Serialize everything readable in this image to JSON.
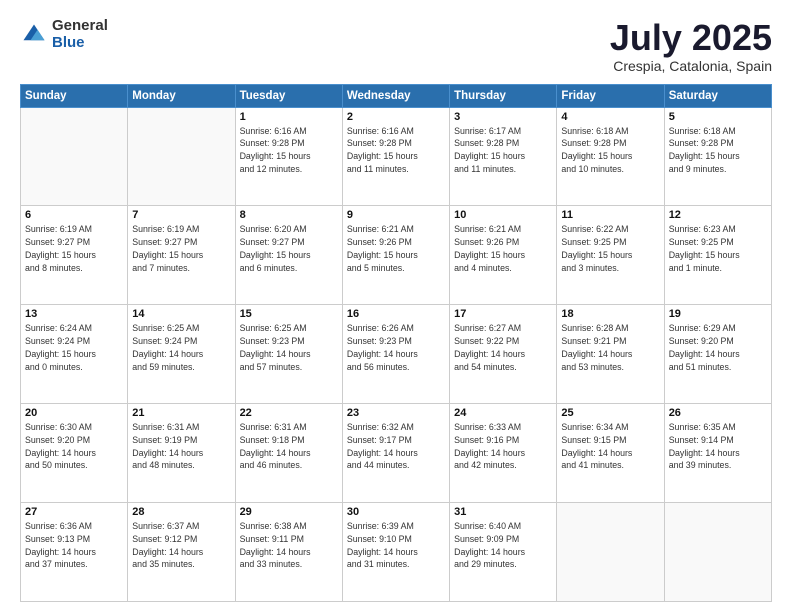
{
  "logo": {
    "general": "General",
    "blue": "Blue"
  },
  "title": {
    "month": "July 2025",
    "location": "Crespia, Catalonia, Spain"
  },
  "weekdays": [
    "Sunday",
    "Monday",
    "Tuesday",
    "Wednesday",
    "Thursday",
    "Friday",
    "Saturday"
  ],
  "weeks": [
    [
      {
        "day": "",
        "info": ""
      },
      {
        "day": "",
        "info": ""
      },
      {
        "day": "1",
        "info": "Sunrise: 6:16 AM\nSunset: 9:28 PM\nDaylight: 15 hours\nand 12 minutes."
      },
      {
        "day": "2",
        "info": "Sunrise: 6:16 AM\nSunset: 9:28 PM\nDaylight: 15 hours\nand 11 minutes."
      },
      {
        "day": "3",
        "info": "Sunrise: 6:17 AM\nSunset: 9:28 PM\nDaylight: 15 hours\nand 11 minutes."
      },
      {
        "day": "4",
        "info": "Sunrise: 6:18 AM\nSunset: 9:28 PM\nDaylight: 15 hours\nand 10 minutes."
      },
      {
        "day": "5",
        "info": "Sunrise: 6:18 AM\nSunset: 9:28 PM\nDaylight: 15 hours\nand 9 minutes."
      }
    ],
    [
      {
        "day": "6",
        "info": "Sunrise: 6:19 AM\nSunset: 9:27 PM\nDaylight: 15 hours\nand 8 minutes."
      },
      {
        "day": "7",
        "info": "Sunrise: 6:19 AM\nSunset: 9:27 PM\nDaylight: 15 hours\nand 7 minutes."
      },
      {
        "day": "8",
        "info": "Sunrise: 6:20 AM\nSunset: 9:27 PM\nDaylight: 15 hours\nand 6 minutes."
      },
      {
        "day": "9",
        "info": "Sunrise: 6:21 AM\nSunset: 9:26 PM\nDaylight: 15 hours\nand 5 minutes."
      },
      {
        "day": "10",
        "info": "Sunrise: 6:21 AM\nSunset: 9:26 PM\nDaylight: 15 hours\nand 4 minutes."
      },
      {
        "day": "11",
        "info": "Sunrise: 6:22 AM\nSunset: 9:25 PM\nDaylight: 15 hours\nand 3 minutes."
      },
      {
        "day": "12",
        "info": "Sunrise: 6:23 AM\nSunset: 9:25 PM\nDaylight: 15 hours\nand 1 minute."
      }
    ],
    [
      {
        "day": "13",
        "info": "Sunrise: 6:24 AM\nSunset: 9:24 PM\nDaylight: 15 hours\nand 0 minutes."
      },
      {
        "day": "14",
        "info": "Sunrise: 6:25 AM\nSunset: 9:24 PM\nDaylight: 14 hours\nand 59 minutes."
      },
      {
        "day": "15",
        "info": "Sunrise: 6:25 AM\nSunset: 9:23 PM\nDaylight: 14 hours\nand 57 minutes."
      },
      {
        "day": "16",
        "info": "Sunrise: 6:26 AM\nSunset: 9:23 PM\nDaylight: 14 hours\nand 56 minutes."
      },
      {
        "day": "17",
        "info": "Sunrise: 6:27 AM\nSunset: 9:22 PM\nDaylight: 14 hours\nand 54 minutes."
      },
      {
        "day": "18",
        "info": "Sunrise: 6:28 AM\nSunset: 9:21 PM\nDaylight: 14 hours\nand 53 minutes."
      },
      {
        "day": "19",
        "info": "Sunrise: 6:29 AM\nSunset: 9:20 PM\nDaylight: 14 hours\nand 51 minutes."
      }
    ],
    [
      {
        "day": "20",
        "info": "Sunrise: 6:30 AM\nSunset: 9:20 PM\nDaylight: 14 hours\nand 50 minutes."
      },
      {
        "day": "21",
        "info": "Sunrise: 6:31 AM\nSunset: 9:19 PM\nDaylight: 14 hours\nand 48 minutes."
      },
      {
        "day": "22",
        "info": "Sunrise: 6:31 AM\nSunset: 9:18 PM\nDaylight: 14 hours\nand 46 minutes."
      },
      {
        "day": "23",
        "info": "Sunrise: 6:32 AM\nSunset: 9:17 PM\nDaylight: 14 hours\nand 44 minutes."
      },
      {
        "day": "24",
        "info": "Sunrise: 6:33 AM\nSunset: 9:16 PM\nDaylight: 14 hours\nand 42 minutes."
      },
      {
        "day": "25",
        "info": "Sunrise: 6:34 AM\nSunset: 9:15 PM\nDaylight: 14 hours\nand 41 minutes."
      },
      {
        "day": "26",
        "info": "Sunrise: 6:35 AM\nSunset: 9:14 PM\nDaylight: 14 hours\nand 39 minutes."
      }
    ],
    [
      {
        "day": "27",
        "info": "Sunrise: 6:36 AM\nSunset: 9:13 PM\nDaylight: 14 hours\nand 37 minutes."
      },
      {
        "day": "28",
        "info": "Sunrise: 6:37 AM\nSunset: 9:12 PM\nDaylight: 14 hours\nand 35 minutes."
      },
      {
        "day": "29",
        "info": "Sunrise: 6:38 AM\nSunset: 9:11 PM\nDaylight: 14 hours\nand 33 minutes."
      },
      {
        "day": "30",
        "info": "Sunrise: 6:39 AM\nSunset: 9:10 PM\nDaylight: 14 hours\nand 31 minutes."
      },
      {
        "day": "31",
        "info": "Sunrise: 6:40 AM\nSunset: 9:09 PM\nDaylight: 14 hours\nand 29 minutes."
      },
      {
        "day": "",
        "info": ""
      },
      {
        "day": "",
        "info": ""
      }
    ]
  ]
}
